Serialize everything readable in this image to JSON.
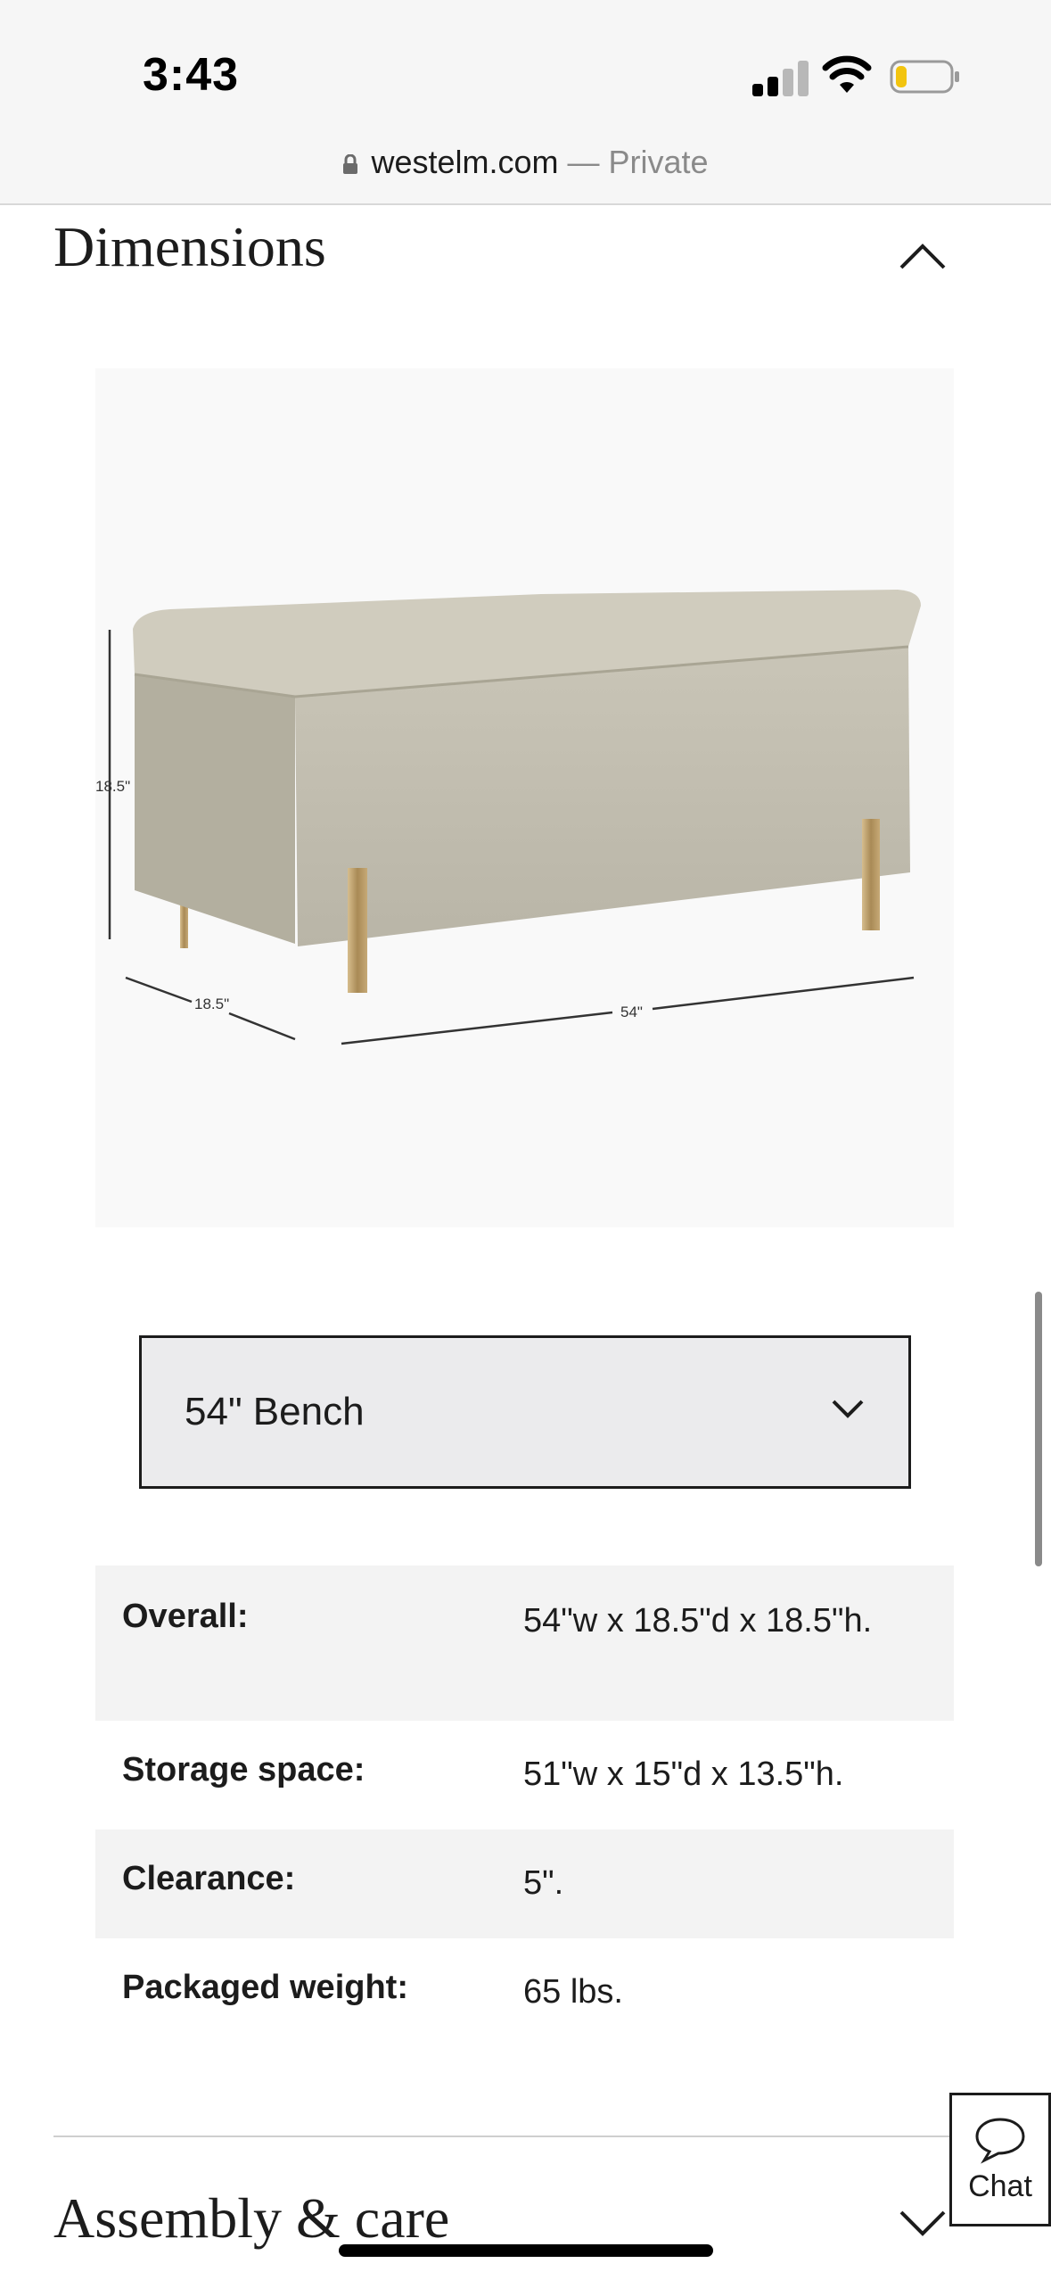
{
  "status_bar": {
    "time": "3:43",
    "signal_bars": 2,
    "battery_level": 0.15
  },
  "url_bar": {
    "domain": "westelm.com",
    "separator": "—",
    "mode": "Private"
  },
  "dimensions_section": {
    "title": "Dimensions",
    "expanded": true,
    "image": {
      "height_label": "18.5\"",
      "depth_label": "18.5\"",
      "width_label": "54\""
    },
    "size_select": {
      "selected": "54\" Bench"
    },
    "rows": [
      {
        "label": "Overall:",
        "value": "54\"w x 18.5\"d x 18.5\"h."
      },
      {
        "label": "Storage space:",
        "value": "51\"w x 15\"d x 13.5\"h."
      },
      {
        "label": "Clearance:",
        "value": "5\"."
      },
      {
        "label": "Packaged weight:",
        "value": "65 lbs."
      }
    ]
  },
  "assembly_section": {
    "title": "Assembly & care",
    "expanded": false
  },
  "chat": {
    "label": "Chat"
  },
  "colors": {
    "fabric": "#cac6b8",
    "legs": "#b89d6c",
    "row_shade": "#f3f3f3",
    "select_bg": "#ebebed"
  }
}
